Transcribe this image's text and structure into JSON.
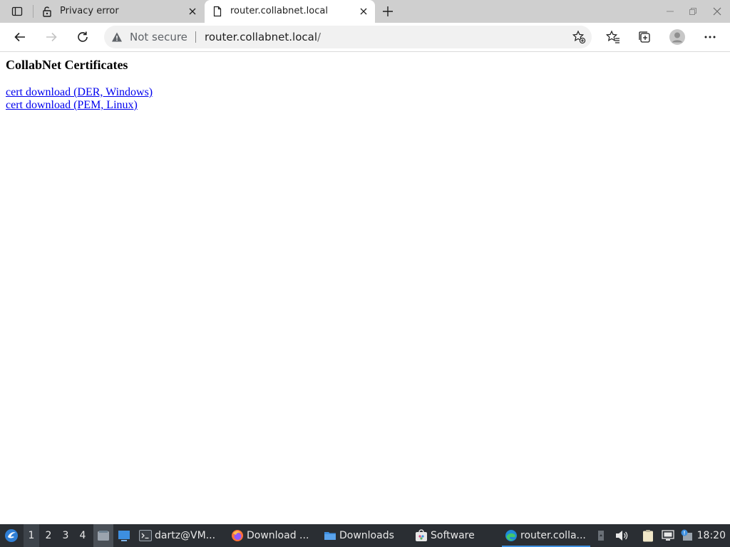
{
  "browser": {
    "tabs": [
      {
        "title": "Privacy error",
        "favicon": "broken-lock-icon",
        "active": false
      },
      {
        "title": "router.collabnet.local",
        "favicon": "page-icon",
        "active": true
      }
    ],
    "address": {
      "security_label": "Not secure",
      "host": "router.collabnet.local",
      "path": "/"
    }
  },
  "page": {
    "heading": "CollabNet Certificates",
    "links": [
      {
        "label": "cert download (DER, Windows)"
      },
      {
        "label": "cert download (PEM, Linux)"
      }
    ]
  },
  "taskbar": {
    "workspaces": [
      "1",
      "2",
      "3",
      "4"
    ],
    "current_workspace": "1",
    "tasks": [
      {
        "label": "dartz@VM...",
        "icon": "terminal-icon"
      },
      {
        "label": "Download ...",
        "icon": "firefox-icon"
      },
      {
        "label": "Downloads",
        "icon": "folder-icon"
      },
      {
        "label": "Software",
        "icon": "software-icon"
      },
      {
        "label": "router.colla...",
        "icon": "edge-icon",
        "active": true
      }
    ],
    "clock": "18:20"
  },
  "colors": {
    "taskbar_bg": "#2a2e33",
    "tabstrip_bg": "#cfcfcf",
    "link": "#0000ee",
    "active_task_underline": "#3d8fe0"
  }
}
